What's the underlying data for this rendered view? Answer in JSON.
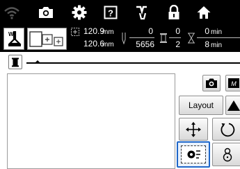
{
  "colors": {
    "bar_bg": "#000000",
    "accent_selected": "#1e66c8",
    "panel_border": "#9a9a9a"
  },
  "top_icons": [
    "wifi-icon",
    "camera-icon",
    "gear-icon",
    "help-icon",
    "hands-free-icon",
    "lock-icon",
    "home-icon"
  ],
  "info": {
    "width_value": "120.9",
    "width_unit": "mm",
    "height_value": "120.6",
    "height_unit": "mm",
    "stitch_current": "0",
    "stitch_total": "5656",
    "color_current": "0",
    "color_total": "2",
    "time_current": "0",
    "time_total": "8",
    "time_unit": "min"
  },
  "toolbar": {
    "layout_label": "Layout"
  }
}
